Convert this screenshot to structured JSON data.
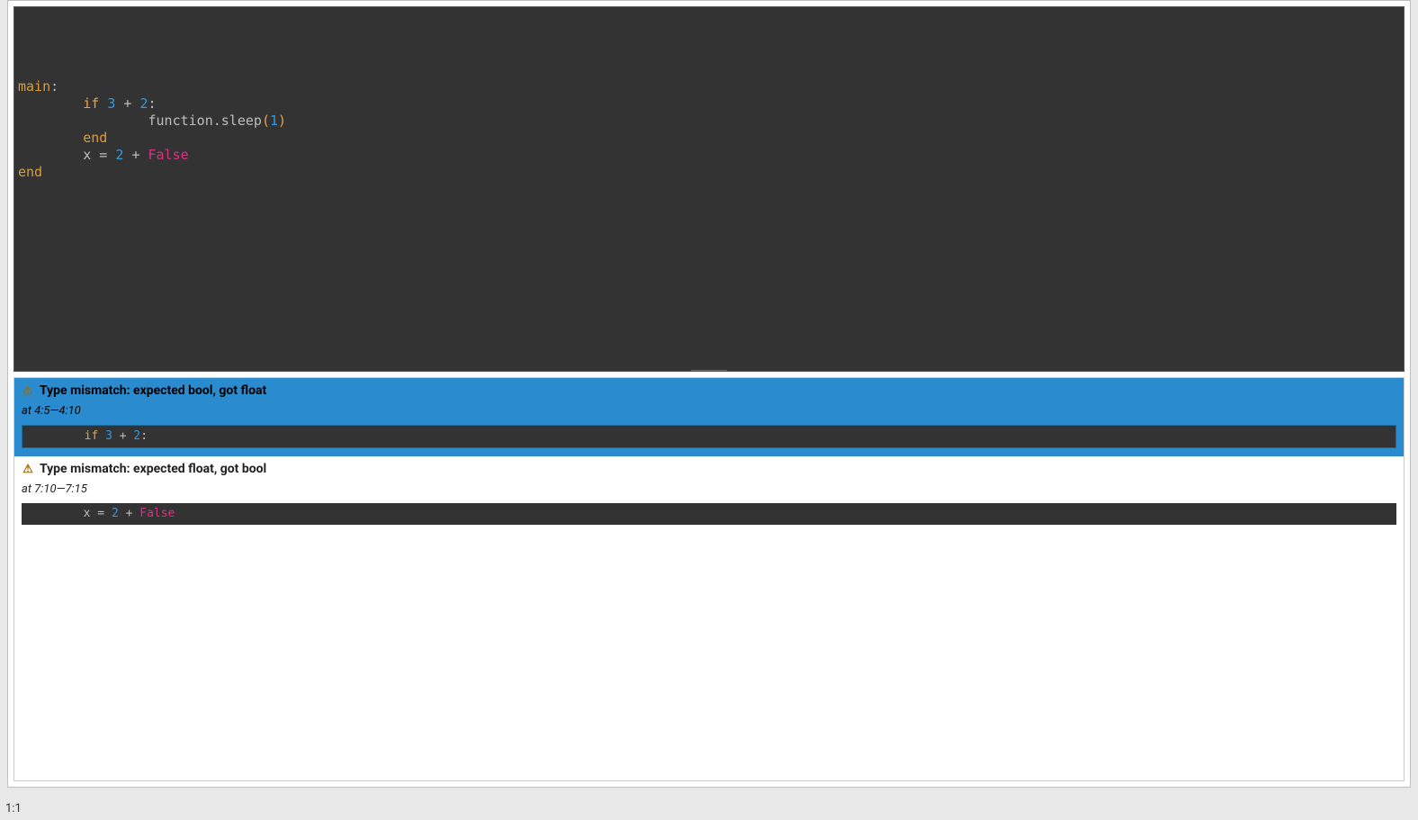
{
  "editor": {
    "tokens": [
      [],
      [],
      [
        {
          "cls": "tok-kw1",
          "t": "main"
        },
        {
          "cls": "tok-punct",
          "t": ":"
        }
      ],
      [
        {
          "cls": "",
          "t": "        "
        },
        {
          "cls": "tok-kw2",
          "t": "if"
        },
        {
          "cls": "",
          "t": " "
        },
        {
          "cls": "tok-num",
          "t": "3"
        },
        {
          "cls": "",
          "t": " "
        },
        {
          "cls": "tok-op",
          "t": "+"
        },
        {
          "cls": "",
          "t": " "
        },
        {
          "cls": "tok-num",
          "t": "2"
        },
        {
          "cls": "tok-punct",
          "t": ":"
        }
      ],
      [
        {
          "cls": "",
          "t": "                "
        },
        {
          "cls": "tok-func",
          "t": "function.sleep"
        },
        {
          "cls": "tok-paren",
          "t": "("
        },
        {
          "cls": "tok-num",
          "t": "1"
        },
        {
          "cls": "tok-paren",
          "t": ")"
        }
      ],
      [
        {
          "cls": "",
          "t": "        "
        },
        {
          "cls": "tok-kw1",
          "t": "end"
        }
      ],
      [
        {
          "cls": "",
          "t": "        "
        },
        {
          "cls": "tok-op",
          "t": "x = "
        },
        {
          "cls": "tok-num",
          "t": "2"
        },
        {
          "cls": "",
          "t": " "
        },
        {
          "cls": "tok-op",
          "t": "+"
        },
        {
          "cls": "",
          "t": " "
        },
        {
          "cls": "tok-bool",
          "t": "False"
        }
      ],
      [
        {
          "cls": "tok-kw1",
          "t": "end"
        }
      ]
    ]
  },
  "problems": [
    {
      "selected": true,
      "icon": "⚠",
      "title": "Type mismatch: expected bool, got float",
      "location": "at 4:5—4:10",
      "snippet_tokens": [
        {
          "cls": "",
          "t": "        "
        },
        {
          "cls": "tok-kw2",
          "t": "if"
        },
        {
          "cls": "",
          "t": " "
        },
        {
          "cls": "tok-num",
          "t": "3"
        },
        {
          "cls": "",
          "t": " "
        },
        {
          "cls": "tok-op",
          "t": "+"
        },
        {
          "cls": "",
          "t": " "
        },
        {
          "cls": "tok-num",
          "t": "2"
        },
        {
          "cls": "tok-punct",
          "t": ":"
        }
      ]
    },
    {
      "selected": false,
      "icon": "⚠",
      "title": "Type mismatch: expected float, got bool",
      "location": "at 7:10—7:15",
      "snippet_tokens": [
        {
          "cls": "",
          "t": "        "
        },
        {
          "cls": "tok-op",
          "t": "x = "
        },
        {
          "cls": "tok-num",
          "t": "2"
        },
        {
          "cls": "",
          "t": " "
        },
        {
          "cls": "tok-op",
          "t": "+"
        },
        {
          "cls": "",
          "t": " "
        },
        {
          "cls": "tok-bool",
          "t": "False"
        }
      ]
    }
  ],
  "status": {
    "cursor": "1:1"
  }
}
